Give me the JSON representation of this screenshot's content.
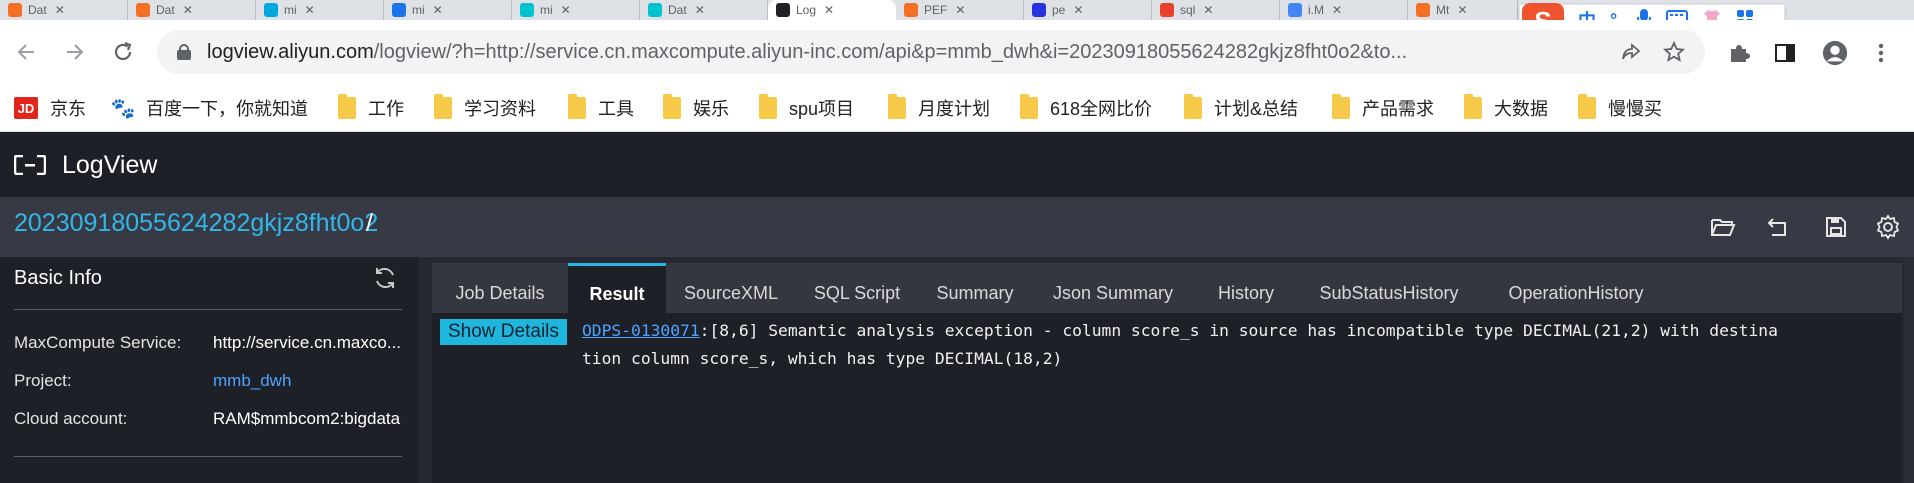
{
  "browser": {
    "tabs": [
      {
        "label": "Dat",
        "color": "#f36f21"
      },
      {
        "label": "Dat",
        "color": "#f36f21"
      },
      {
        "label": "mi",
        "color": "#00a8e0"
      },
      {
        "label": "mi",
        "color": "#1a73e8"
      },
      {
        "label": "mi",
        "color": "#00c3d0"
      },
      {
        "label": "Dat",
        "color": "#00c3d0"
      },
      {
        "label": "Log",
        "color": "#202124",
        "active": true
      },
      {
        "label": "PEF",
        "color": "#f36f21"
      },
      {
        "label": "pe",
        "color": "#2932e1"
      },
      {
        "label": "sql",
        "color": "#e8412c"
      },
      {
        "label": "i.M",
        "color": "#4285f4"
      },
      {
        "label": "Mt",
        "color": "#f36f21"
      }
    ],
    "url_host": "logview.aliyun.com",
    "url_path": "/logview/?h=http://service.cn.maxcompute.aliyun-inc.com/api&p=mmb_dwh&i=20230918055624282gkjz8fht0o2&to...",
    "ime": {
      "logo": "S",
      "mode": "中",
      "punct": "°,"
    }
  },
  "bookmarks": [
    {
      "label": "京东",
      "icon": "jd-icon",
      "badge": "JD"
    },
    {
      "label": "百度一下，你就知道",
      "icon": "baidu-paw-icon",
      "glyph": "🐾"
    },
    {
      "label": "工作",
      "icon": "folder-icon"
    },
    {
      "label": "学习资料",
      "icon": "folder-icon"
    },
    {
      "label": "工具",
      "icon": "folder-icon"
    },
    {
      "label": "娱乐",
      "icon": "folder-icon"
    },
    {
      "label": "spu项目",
      "icon": "folder-icon"
    },
    {
      "label": "月度计划",
      "icon": "folder-icon"
    },
    {
      "label": "618全网比价",
      "icon": "folder-icon"
    },
    {
      "label": "计划&总结",
      "icon": "folder-icon"
    },
    {
      "label": "产品需求",
      "icon": "folder-icon"
    },
    {
      "label": "大数据",
      "icon": "folder-icon"
    },
    {
      "label": "慢慢买",
      "icon": "folder-icon"
    }
  ],
  "app": {
    "title": "LogView",
    "job_id": "20230918055624282gkjz8fht0o2",
    "separator": "/"
  },
  "basic_info": {
    "title": "Basic Info",
    "rows": [
      {
        "label": "MaxCompute Service:",
        "value": "http://service.cn.maxco..."
      },
      {
        "label": "Project:",
        "value": "mmb_dwh"
      },
      {
        "label": "Cloud account:",
        "value": "RAM$mmbcom2:bigdata"
      }
    ]
  },
  "tabs": [
    {
      "label": "Job Details"
    },
    {
      "label": "Result",
      "active": true
    },
    {
      "label": "SourceXML"
    },
    {
      "label": "SQL Script"
    },
    {
      "label": "Summary"
    },
    {
      "label": "Json Summary"
    },
    {
      "label": "History"
    },
    {
      "label": "SubStatusHistory"
    },
    {
      "label": "OperationHistory"
    }
  ],
  "result": {
    "show_details_label": "Show Details",
    "error_code": "ODPS-0130071",
    "error_line1": ":[8,6] Semantic analysis exception - column score_s in source has incompatible type DECIMAL(21,2) with destina",
    "error_line2": "tion column score_s, which has type DECIMAL(18,2)"
  },
  "colors": {
    "accent": "#27b9e6",
    "link": "#4da3ff",
    "header_bg": "#1e2027",
    "idbar_bg": "#373a45"
  }
}
